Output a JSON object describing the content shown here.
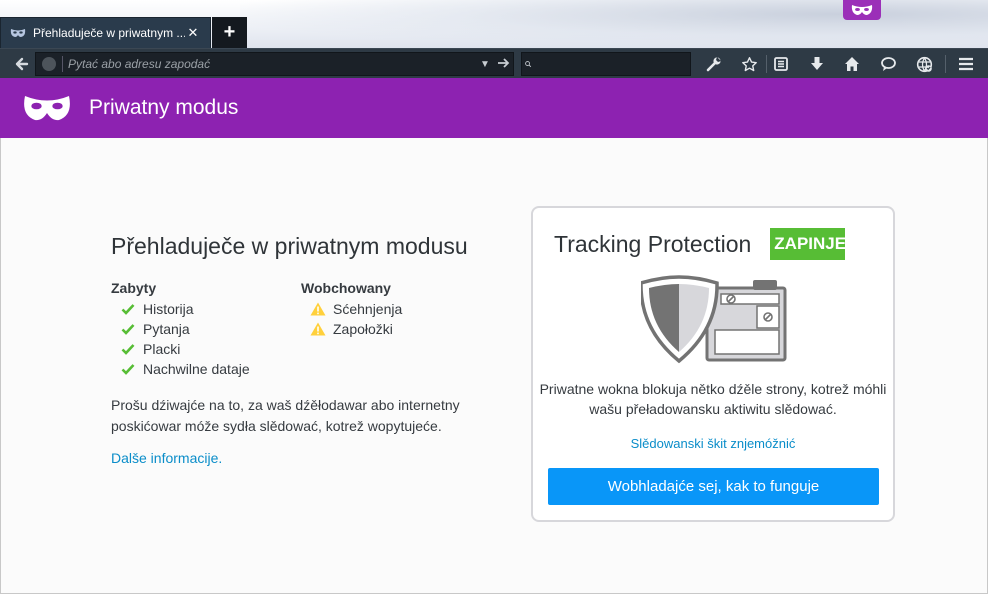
{
  "window": {
    "tab_title": "Přehladuječe w priwatnym ...",
    "close_glyph": "✕",
    "newtab_glyph": "+"
  },
  "toolbar": {
    "url_placeholder": "Pytać abo adresu zapodać",
    "icons": [
      "back-icon",
      "dropdown-icon",
      "go-icon",
      "search-icon",
      "wrench-icon",
      "star-icon",
      "reading-list-icon",
      "download-icon",
      "home-icon",
      "chat-icon",
      "private-globe-icon",
      "menu-icon"
    ]
  },
  "header": {
    "title": "Priwatny modus"
  },
  "left": {
    "heading": "Přehladuječe w priwatnym modusu",
    "forgotten_title": "Zabyty",
    "forgotten_items": [
      "Historija",
      "Pytanja",
      "Placki",
      "Nachwilne dataje"
    ],
    "kept_title": "Wobchowany",
    "kept_items": [
      "Sćehnjenja",
      "Zapołožki"
    ],
    "note": "Prošu dźiwajće na to, za waš dźěłodawar abo internetny poskićowar móže sydła slědować, kotrež wopytujeće.",
    "more_link": "Dalše informacije."
  },
  "card": {
    "title": "Tracking Protection",
    "status_badge": "ZAPINJENY",
    "description": "Priwatne wokna blokuja nětko dźěle strony, kotrež móhli wašu přeładowansku aktiwitu slědować.",
    "disable_link": "Slědowanski škit znjemóžnić",
    "cta_button": "Wobhladajće sej, kak to funguje"
  },
  "colors": {
    "header_purple": "#8d22b1",
    "badge_green": "#57bd35",
    "cta_blue": "#0996f8",
    "link_blue": "#0a8dc9",
    "check_green": "#57bd35",
    "warn_yellow": "#ffd03c"
  }
}
